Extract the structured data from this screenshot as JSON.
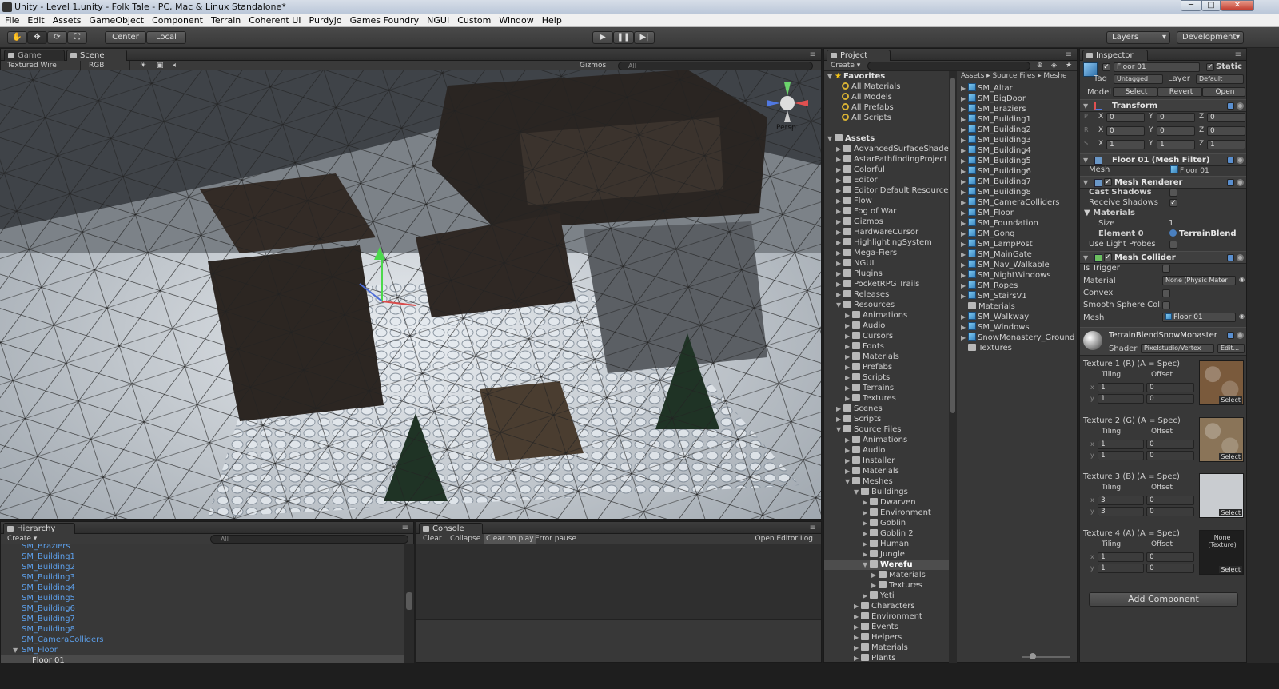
{
  "window": {
    "title": "Unity - Level 1.unity - Folk Tale - PC, Mac & Linux Standalone*",
    "minimize": "─",
    "maximize": "□",
    "close": "✕"
  },
  "menu": [
    "File",
    "Edit",
    "Assets",
    "GameObject",
    "Component",
    "Terrain",
    "Coherent UI",
    "Purdyjo",
    "Games Foundry",
    "NGUI",
    "Custom",
    "Window",
    "Help"
  ],
  "toolbar": {
    "center": "Center",
    "local": "Local",
    "layers": "Layers",
    "layout": "Development",
    "play": "▶",
    "pause": "❚❚",
    "step": "▶|"
  },
  "scene": {
    "tab_game": "Game",
    "tab_scene": "Scene",
    "render_mode": "Textured Wire",
    "channel": "RGB",
    "gizmos": "Gizmos",
    "search": "All",
    "persp": "Persp"
  },
  "hierarchy": {
    "tab": "Hierarchy",
    "create": "Create",
    "search": "All",
    "items": [
      {
        "label": "SM_Braziers",
        "indent": 0
      },
      {
        "label": "SM_Building1",
        "indent": 0
      },
      {
        "label": "SM_Building2",
        "indent": 0
      },
      {
        "label": "SM_Building3",
        "indent": 0
      },
      {
        "label": "SM_Building4",
        "indent": 0
      },
      {
        "label": "SM_Building5",
        "indent": 0
      },
      {
        "label": "SM_Building6",
        "indent": 0
      },
      {
        "label": "SM_Building7",
        "indent": 0
      },
      {
        "label": "SM_Building8",
        "indent": 0
      },
      {
        "label": "SM_CameraColliders",
        "indent": 0
      },
      {
        "label": "SM_Floor",
        "indent": 0,
        "open": true
      },
      {
        "label": "Floor 01",
        "indent": 1,
        "selected": true
      }
    ]
  },
  "console": {
    "tab": "Console",
    "clear": "Clear",
    "collapse": "Collapse",
    "clear_on_play": "Clear on play",
    "error_pause": "Error pause",
    "open_log": "Open Editor Log"
  },
  "project": {
    "tab": "Project",
    "create": "Create",
    "favorites_header": "Favorites",
    "favorites": [
      "All Materials",
      "All Models",
      "All Prefabs",
      "All Scripts"
    ],
    "assets_header": "Assets",
    "tree": [
      {
        "label": "AdvancedSurfaceShaders",
        "d": 1
      },
      {
        "label": "AstarPathfindingProject",
        "d": 1
      },
      {
        "label": "Colorful",
        "d": 1
      },
      {
        "label": "Editor",
        "d": 1
      },
      {
        "label": "Editor Default Resources",
        "d": 1
      },
      {
        "label": "Flow",
        "d": 1
      },
      {
        "label": "Fog of War",
        "d": 1
      },
      {
        "label": "Gizmos",
        "d": 1
      },
      {
        "label": "HardwareCursor",
        "d": 1
      },
      {
        "label": "HighlightingSystem",
        "d": 1
      },
      {
        "label": "Mega-Fiers",
        "d": 1
      },
      {
        "label": "NGUI",
        "d": 1
      },
      {
        "label": "Plugins",
        "d": 1
      },
      {
        "label": "PocketRPG Trails",
        "d": 1
      },
      {
        "label": "Releases",
        "d": 1
      },
      {
        "label": "Resources",
        "d": 1,
        "open": true
      },
      {
        "label": "Animations",
        "d": 2
      },
      {
        "label": "Audio",
        "d": 2
      },
      {
        "label": "Cursors",
        "d": 2
      },
      {
        "label": "Fonts",
        "d": 2
      },
      {
        "label": "Materials",
        "d": 2
      },
      {
        "label": "Prefabs",
        "d": 2
      },
      {
        "label": "Scripts",
        "d": 2
      },
      {
        "label": "Terrains",
        "d": 2
      },
      {
        "label": "Textures",
        "d": 2
      },
      {
        "label": "Scenes",
        "d": 1
      },
      {
        "label": "Scripts",
        "d": 1
      },
      {
        "label": "Source Files",
        "d": 1,
        "open": true
      },
      {
        "label": "Animations",
        "d": 2
      },
      {
        "label": "Audio",
        "d": 2
      },
      {
        "label": "Installer",
        "d": 2
      },
      {
        "label": "Materials",
        "d": 2
      },
      {
        "label": "Meshes",
        "d": 2,
        "open": true
      },
      {
        "label": "Buildings",
        "d": 3,
        "open": true
      },
      {
        "label": "Dwarven",
        "d": 4
      },
      {
        "label": "Environment",
        "d": 4
      },
      {
        "label": "Goblin",
        "d": 4
      },
      {
        "label": "Goblin 2",
        "d": 4
      },
      {
        "label": "Human",
        "d": 4
      },
      {
        "label": "Jungle",
        "d": 4
      },
      {
        "label": "Werefu",
        "d": 4,
        "open": true,
        "selected": true
      },
      {
        "label": "Materials",
        "d": 5
      },
      {
        "label": "Textures",
        "d": 5
      },
      {
        "label": "Yeti",
        "d": 4
      },
      {
        "label": "Characters",
        "d": 3
      },
      {
        "label": "Environment",
        "d": 3
      },
      {
        "label": "Events",
        "d": 3
      },
      {
        "label": "Helpers",
        "d": 3
      },
      {
        "label": "Materials",
        "d": 3
      },
      {
        "label": "Plants",
        "d": 3
      }
    ],
    "breadcrumb": [
      "Assets",
      "Source Files",
      "Meshe"
    ],
    "files": [
      {
        "label": "SM_Altar",
        "mesh": true
      },
      {
        "label": "SM_BigDoor",
        "mesh": true
      },
      {
        "label": "SM_Braziers",
        "mesh": true
      },
      {
        "label": "SM_Building1",
        "mesh": true
      },
      {
        "label": "SM_Building2",
        "mesh": true
      },
      {
        "label": "SM_Building3",
        "mesh": true
      },
      {
        "label": "SM_Building4",
        "mesh": true
      },
      {
        "label": "SM_Building5",
        "mesh": true
      },
      {
        "label": "SM_Building6",
        "mesh": true
      },
      {
        "label": "SM_Building7",
        "mesh": true
      },
      {
        "label": "SM_Building8",
        "mesh": true
      },
      {
        "label": "SM_CameraColliders",
        "mesh": true
      },
      {
        "label": "SM_Floor",
        "mesh": true
      },
      {
        "label": "SM_Foundation",
        "mesh": true
      },
      {
        "label": "SM_Gong",
        "mesh": true
      },
      {
        "label": "SM_LampPost",
        "mesh": true
      },
      {
        "label": "SM_MainGate",
        "mesh": true
      },
      {
        "label": "SM_Nav_Walkable",
        "mesh": true
      },
      {
        "label": "SM_NightWindows",
        "mesh": true
      },
      {
        "label": "SM_Ropes",
        "mesh": true
      },
      {
        "label": "SM_StairsV1",
        "mesh": true
      },
      {
        "label": "Materials",
        "mesh": false
      },
      {
        "label": "SM_Walkway",
        "mesh": true
      },
      {
        "label": "SM_Windows",
        "mesh": true
      },
      {
        "label": "SnowMonastery_Ground",
        "mesh": true
      },
      {
        "label": "Textures",
        "mesh": false
      }
    ]
  },
  "inspector": {
    "tab": "Inspector",
    "name": "Floor 01",
    "static": "Static",
    "tag_label": "Tag",
    "tag": "Untagged",
    "layer_label": "Layer",
    "layer": "Default",
    "model_label": "Model",
    "select": "Select",
    "revert": "Revert",
    "open": "Open",
    "transform": {
      "title": "Transform",
      "rows": [
        {
          "k": "P",
          "x": "0",
          "y": "0",
          "z": "0"
        },
        {
          "k": "R",
          "x": "0",
          "y": "0",
          "z": "0"
        },
        {
          "k": "S",
          "x": "1",
          "y": "1",
          "z": "1"
        }
      ]
    },
    "mesh_filter": {
      "title": "Floor 01 (Mesh Filter)",
      "mesh_label": "Mesh",
      "mesh": "Floor 01"
    },
    "mesh_renderer": {
      "title": "Mesh Renderer",
      "cast": "Cast Shadows",
      "receive": "Receive Shadows",
      "materials": "Materials",
      "size_label": "Size",
      "size": "1",
      "element_label": "Element 0",
      "element": "TerrainBlend",
      "probes": "Use Light Probes"
    },
    "mesh_collider": {
      "title": "Mesh Collider",
      "trigger": "Is Trigger",
      "material_label": "Material",
      "material": "None (Physic Mater",
      "convex": "Convex",
      "smooth": "Smooth Sphere Colli",
      "mesh_label": "Mesh",
      "mesh": "Floor 01"
    },
    "material": {
      "title": "TerrainBlendSnowMonaster",
      "shader_label": "Shader",
      "shader": "Pixelstudio/Vertex",
      "edit": "Edit...",
      "textures": [
        {
          "label": "Texture 1 (R) (A = Spec)",
          "tiling": "Tiling",
          "offset": "Offset",
          "tx": "1",
          "ox": "0",
          "ty": "1",
          "oy": "0",
          "swatch": "#7a5a3c",
          "none": ""
        },
        {
          "label": "Texture 2 (G) (A = Spec)",
          "tiling": "Tiling",
          "offset": "Offset",
          "tx": "1",
          "ox": "0",
          "ty": "1",
          "oy": "0",
          "swatch": "#8a7458",
          "none": ""
        },
        {
          "label": "Texture 3 (B) (A = Spec)",
          "tiling": "Tiling",
          "offset": "Offset",
          "tx": "3",
          "ox": "0",
          "ty": "3",
          "oy": "0",
          "swatch": "#c9ccd0",
          "none": ""
        },
        {
          "label": "Texture 4 (A) (A = Spec)",
          "tiling": "Tiling",
          "offset": "Offset",
          "tx": "1",
          "ox": "0",
          "ty": "1",
          "oy": "0",
          "swatch": "#1e1e1e",
          "none": "None (Texture)"
        }
      ],
      "select": "Select",
      "x": "x",
      "y": "y"
    },
    "add_component": "Add Component"
  }
}
